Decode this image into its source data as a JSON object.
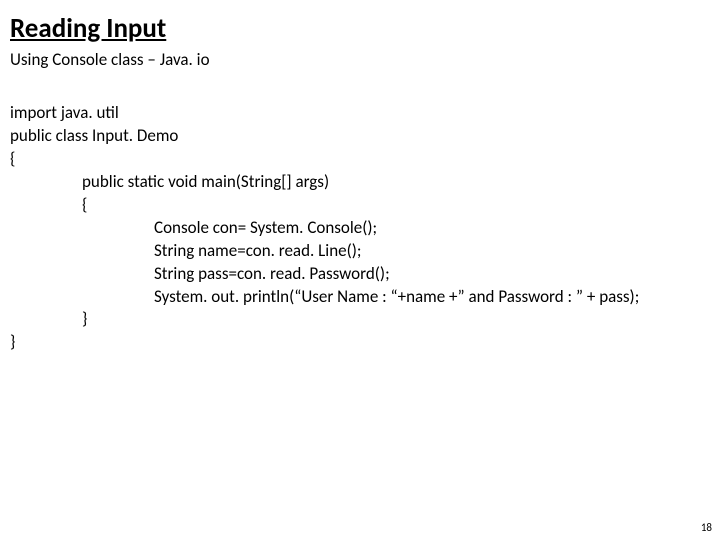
{
  "title": "Reading Input",
  "subtitle": "Using Console class – Java. io",
  "code": {
    "l0_import": "import java. util",
    "l0_class": "public class Input. Demo",
    "l0_openbrace": "{",
    "l1_main": "public static void main(String[] args)",
    "l1_openbrace": "{",
    "l2_a": "Console con= System. Console();",
    "l2_b": "String name=con. read. Line();",
    "l2_c": "String pass=con. read. Password();",
    "l2_d": "System. out. println(“User Name : “+name +” and Password : ” + pass);",
    "l1_closebrace": "}",
    "l0_closebrace": "}"
  },
  "page_number": "18"
}
